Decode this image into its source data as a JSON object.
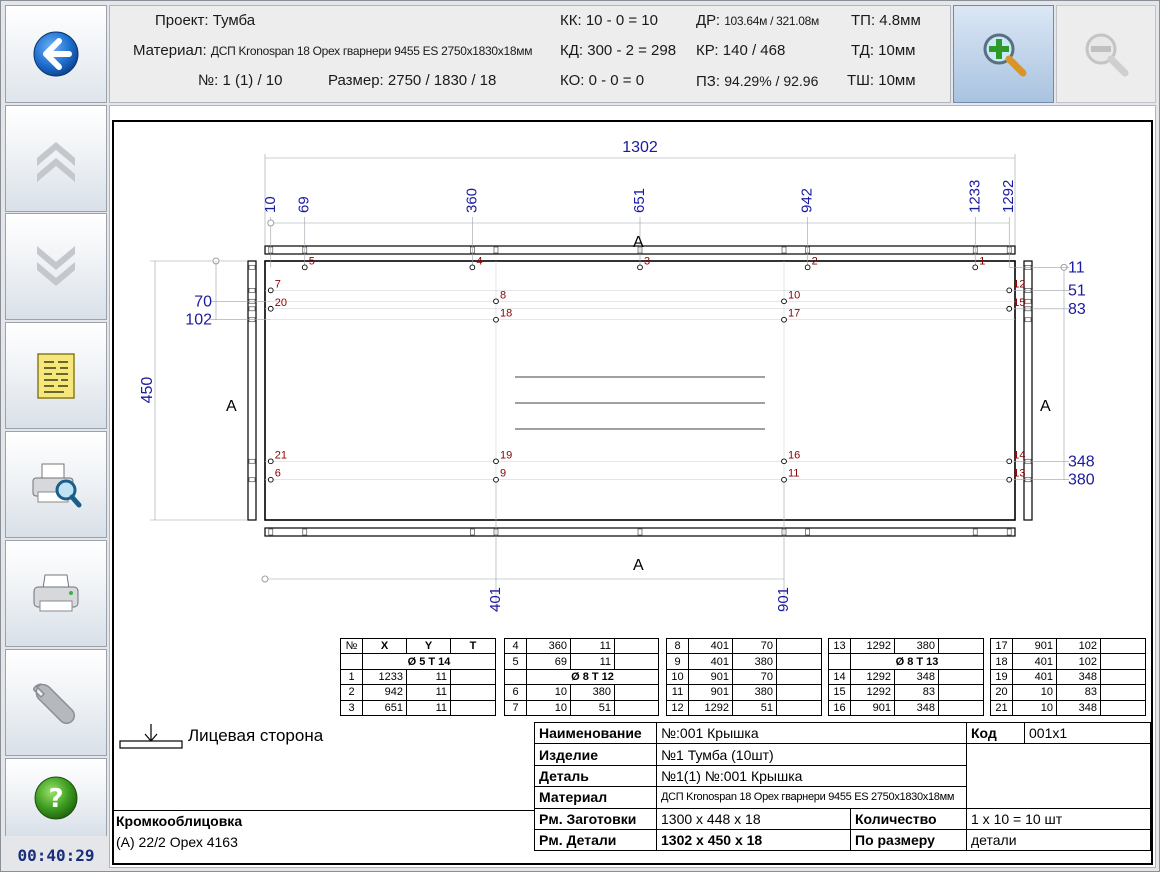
{
  "header": {
    "project_label": "Проект:",
    "project_value": "Тумба",
    "material_label": "Материал:",
    "material_value": "ДСП Kronospan 18 Орех гварнери 9455 ES 2750x1830x18мм",
    "number_label": "№:",
    "number_value": "1 (1)  /  10",
    "size_label": "Размер:",
    "size_value": "2750 / 1830 / 18",
    "kk_label": "КК:",
    "kk_value": "10 - 0 = 10",
    "kd_label": "КД:",
    "kd_value": "300 - 2 = 298",
    "ko_label": "КО:",
    "ko_value": "0 - 0 = 0",
    "dr_label": "ДР:",
    "dr_value": "103.64м / 321.08м",
    "kr_label": "КР:",
    "kr_value": "140 / 468",
    "pz_label": "ПЗ:",
    "pz_value": "94.29% / 92.96",
    "tp_label": "ТП:",
    "tp_value": "4.8мм",
    "td_label": "ТД:",
    "td_value": "10мм",
    "tsh_label": "ТШ:",
    "tsh_value": "10мм"
  },
  "timer": "00:40:29",
  "icons": [
    "back-arrow-icon",
    "scroll-up-icon",
    "scroll-down-icon",
    "report-icon",
    "print-preview-icon",
    "print-icon",
    "settings-wrench-icon",
    "help-icon",
    "zoom-in-icon",
    "zoom-out-icon"
  ],
  "colors": {
    "dimension": "#1a1aa0",
    "hole_label": "#8b0000",
    "accent_blue": "#1565c0",
    "help_green": "#3a9a1e"
  },
  "drawing": {
    "top_total": "1302",
    "top_dims": [
      "10",
      "69",
      "360",
      "651",
      "942",
      "1233",
      "1292"
    ],
    "bottom_dims": [
      "401",
      "901"
    ],
    "left_height": "450",
    "left_dims": [
      "70",
      "102"
    ],
    "right_dims": [
      "11",
      "51",
      "83",
      "348",
      "380"
    ],
    "edge_label": "A",
    "face_side_label": "Лицевая сторона",
    "hole_numbers": [
      "1",
      "2",
      "3",
      "4",
      "5",
      "6",
      "7",
      "8",
      "9",
      "10",
      "11",
      "12",
      "13",
      "14",
      "15",
      "16",
      "17",
      "18",
      "19",
      "20",
      "21"
    ]
  },
  "holes_tables": [
    {
      "header": [
        "№",
        "X",
        "Y",
        "T"
      ],
      "groups": [
        {
          "title": "Ø 5    T 14",
          "rows": [
            [
              "1",
              "1233",
              "11",
              ""
            ],
            [
              "2",
              "942",
              "11",
              ""
            ],
            [
              "3",
              "651",
              "11",
              ""
            ]
          ]
        }
      ]
    },
    {
      "rows_top": [
        [
          "4",
          "360",
          "11",
          ""
        ],
        [
          "5",
          "69",
          "11",
          ""
        ]
      ],
      "title": "Ø 8    T 12",
      "rows_bottom": [
        [
          "6",
          "10",
          "380",
          ""
        ],
        [
          "7",
          "10",
          "51",
          ""
        ]
      ]
    },
    {
      "rows": [
        [
          "8",
          "401",
          "70",
          ""
        ],
        [
          "9",
          "401",
          "380",
          ""
        ],
        [
          "10",
          "901",
          "70",
          ""
        ],
        [
          "11",
          "901",
          "380",
          ""
        ],
        [
          "12",
          "1292",
          "51",
          ""
        ]
      ]
    },
    {
      "rows_top": [
        [
          "13",
          "1292",
          "380",
          ""
        ]
      ],
      "title": "Ø 8    T 13",
      "rows_bottom": [
        [
          "14",
          "1292",
          "348",
          ""
        ],
        [
          "15",
          "1292",
          "83",
          ""
        ],
        [
          "16",
          "901",
          "348",
          ""
        ]
      ]
    },
    {
      "rows": [
        [
          "17",
          "901",
          "102",
          ""
        ],
        [
          "18",
          "401",
          "102",
          ""
        ],
        [
          "19",
          "401",
          "348",
          ""
        ],
        [
          "20",
          "10",
          "83",
          ""
        ],
        [
          "21",
          "10",
          "348",
          ""
        ]
      ]
    }
  ],
  "title_block": {
    "name_label": "Наименование",
    "name_value": "№:001 Крышка",
    "code_label": "Код",
    "code_value": "001x1",
    "product_label": "Изделие",
    "product_value": "№1 Тумба (10шт)",
    "part_label": "Деталь",
    "part_value": "№1(1) №:001 Крышка",
    "material_label": "Материал",
    "material_value": "ДСП Kronospan 18 Орех гварнери 9455 ES 2750x1830x18мм",
    "blank_size_label": "Рм. Заготовки",
    "blank_size_value": "1300 x 448 x 18",
    "quantity_label": "Количество",
    "quantity_value": "1 x 10 = 10 шт",
    "part_size_label": "Рм. Детали",
    "part_size_value": "1302 x 450 x 18",
    "by_size_label": "По размеру",
    "by_size_value": "детали",
    "edge_label": "Кромкооблицовка",
    "edge_value": "(A) 22/2 Орех 4163"
  }
}
